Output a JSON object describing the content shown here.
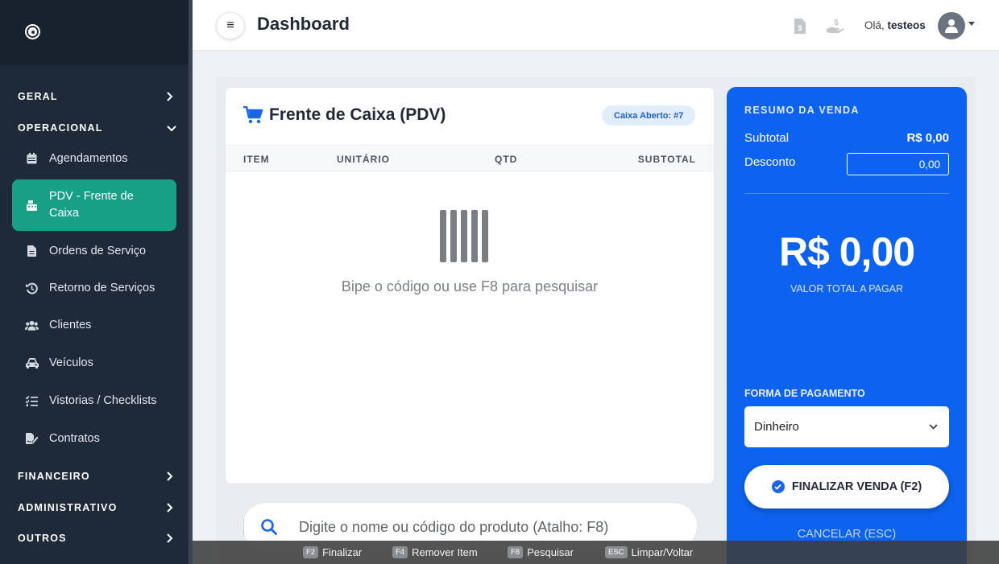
{
  "sidebar": {
    "sections": [
      {
        "label": "GERAL"
      },
      {
        "label": "OPERACIONAL"
      },
      {
        "label": "FINANCEIRO"
      },
      {
        "label": "ADMINISTRATIVO"
      },
      {
        "label": "OUTROS"
      }
    ],
    "items": [
      {
        "label": "Agendamentos",
        "icon": "calendar-icon"
      },
      {
        "label": "PDV - Frente de Caixa",
        "icon": "cash-register-icon"
      },
      {
        "label": "Ordens de Serviço",
        "icon": "file-icon"
      },
      {
        "label": "Retorno de Serviços",
        "icon": "history-icon"
      },
      {
        "label": "Clientes",
        "icon": "users-icon"
      },
      {
        "label": "Veículos",
        "icon": "car-icon"
      },
      {
        "label": "Vistorias / Checklists",
        "icon": "checklist-icon"
      },
      {
        "label": "Contratos",
        "icon": "file-signature-icon"
      }
    ]
  },
  "header": {
    "title": "Dashboard",
    "greeting_prefix": "Olá,",
    "username": "testeos"
  },
  "pdv": {
    "title": "Frente de Caixa (PDV)",
    "badge": "Caixa Aberto: #7",
    "columns": [
      "ITEM",
      "UNITÁRIO",
      "QTD",
      "SUBTOTAL"
    ],
    "empty_message": "Bipe o código ou use F8 para pesquisar",
    "search_placeholder": "Digite o nome ou código do produto (Atalho: F8)"
  },
  "summary": {
    "title": "RESUMO DA VENDA",
    "subtotal_label": "Subtotal",
    "subtotal_value": "R$ 0,00",
    "discount_label": "Desconto",
    "discount_value": "0,00",
    "total_value": "R$ 0,00",
    "total_label": "VALOR TOTAL A PAGAR",
    "payment_label": "FORMA DE PAGAMENTO",
    "payment_selected": "Dinheiro",
    "finalize_label": "FINALIZAR VENDA (F2)",
    "cancel_label": "CANCELAR (ESC)"
  },
  "shortcuts": [
    {
      "key": "F2",
      "label": "Finalizar"
    },
    {
      "key": "F4",
      "label": "Remover Item"
    },
    {
      "key": "F8",
      "label": "Pesquisar"
    },
    {
      "key": "ESC",
      "label": "Limpar/Voltar"
    }
  ],
  "colors": {
    "sidebar_bg": "#1e2a3a",
    "active_item": "#17a085",
    "summary_bg": "#0d63f0",
    "accent": "#1a66e6"
  }
}
